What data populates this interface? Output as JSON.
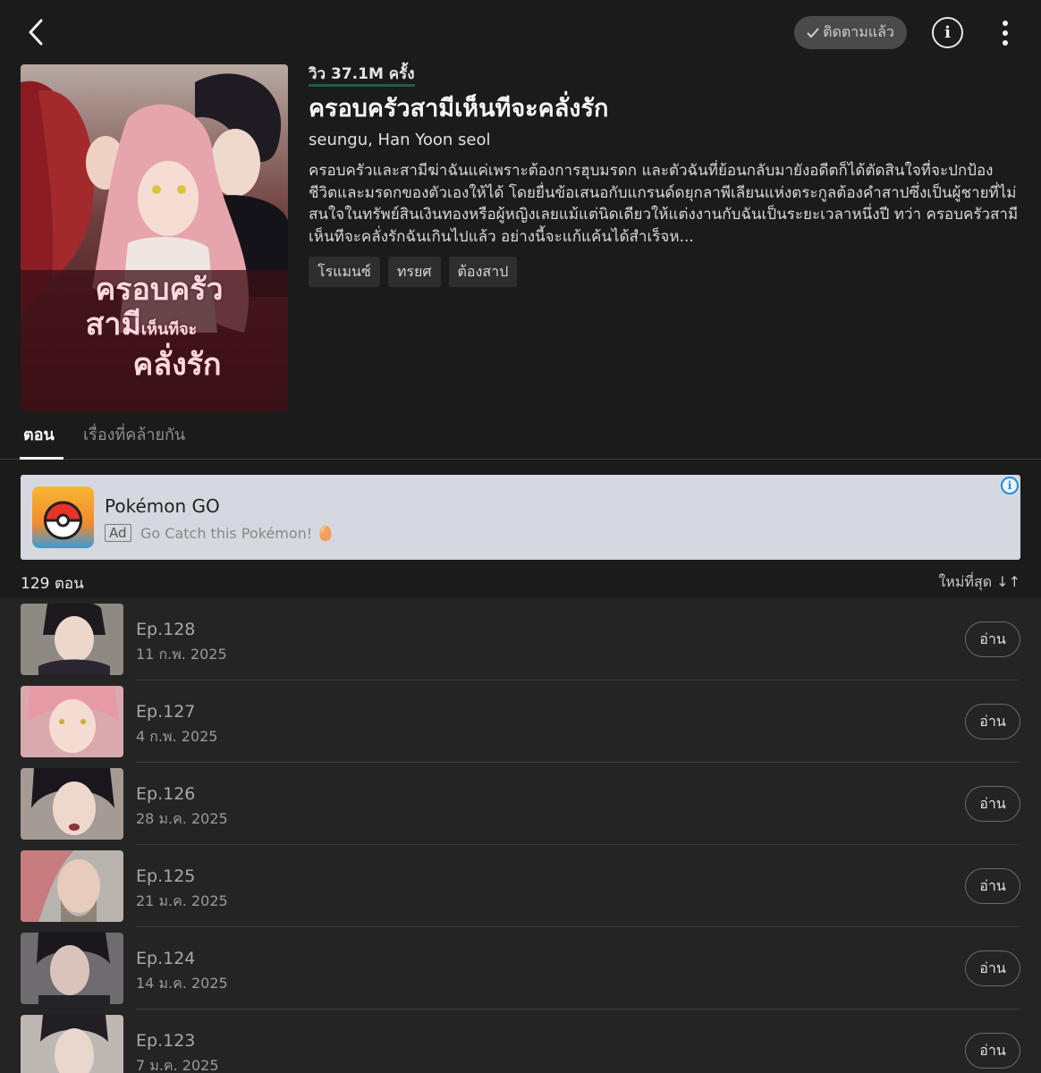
{
  "header": {
    "follow_label": "ติดตามแล้ว",
    "info_label": "i"
  },
  "series": {
    "views": "วิว 37.1M ครั้ง",
    "title": "ครอบครัวสามีเห็นทีจะคลั่งรัก",
    "authors": "seungu, Han Yoon seol",
    "synopsis": "ครอบครัวและสามีฆ่าฉันแค่เพราะต้องการฮุบมรดก และตัวฉันที่ย้อนกลับมายังอดีตก็ได้ตัดสินใจที่จะปกป้องชีวิตและมรดกของตัวเองให้ได้ โดยยื่นข้อเสนอกับแกรนด์ดยุกลาพีเลียนแห่งตระกูลต้องคำสาปซึ่งเป็นผู้ชายที่ไม่สนใจในทรัพย์สินเงินทองหรือผู้หญิงเลยแม้แต่นิดเดียวให้แต่งงานกับฉันเป็นระยะเวลาหนึ่งปี ทว่า ครอบครัวสามีเห็นทีจะคลั่งรักฉันเกินไปแล้ว อย่างนี้จะแก้แค้นได้สำเร็จห...",
    "genres": [
      "โรแมนซ์",
      "ทรยศ",
      "ต้องสาป"
    ],
    "cover_text": [
      "ครอบครัว",
      "สามี",
      "เห็นทีจะ",
      "คลั่งรัก"
    ]
  },
  "tabs": {
    "episodes": "ตอน",
    "similar": "เรื่องที่คล้ายกัน"
  },
  "ad": {
    "title": "Pokémon GO",
    "badge": "Ad",
    "tagline": "Go Catch this Pokémon! 🥚",
    "info_label": "i"
  },
  "list": {
    "count": "129 ตอน",
    "sort": "ใหม่ที่สุด ↓↑"
  },
  "episodes": [
    {
      "title": "Ep.128",
      "date": "11 ก.พ. 2025",
      "read": "อ่าน"
    },
    {
      "title": "Ep.127",
      "date": "4 ก.พ. 2025",
      "read": "อ่าน"
    },
    {
      "title": "Ep.126",
      "date": "28 ม.ค. 2025",
      "read": "อ่าน"
    },
    {
      "title": "Ep.125",
      "date": "21 ม.ค. 2025",
      "read": "อ่าน"
    },
    {
      "title": "Ep.124",
      "date": "14 ม.ค. 2025",
      "read": "อ่าน"
    },
    {
      "title": "Ep.123",
      "date": "7 ม.ค. 2025",
      "read": "อ่าน"
    }
  ],
  "colors": {
    "background": "#1b1b1b",
    "list_background": "#242424",
    "ad_background": "#d6d8df",
    "accent_underline": "#1f5e3f"
  }
}
